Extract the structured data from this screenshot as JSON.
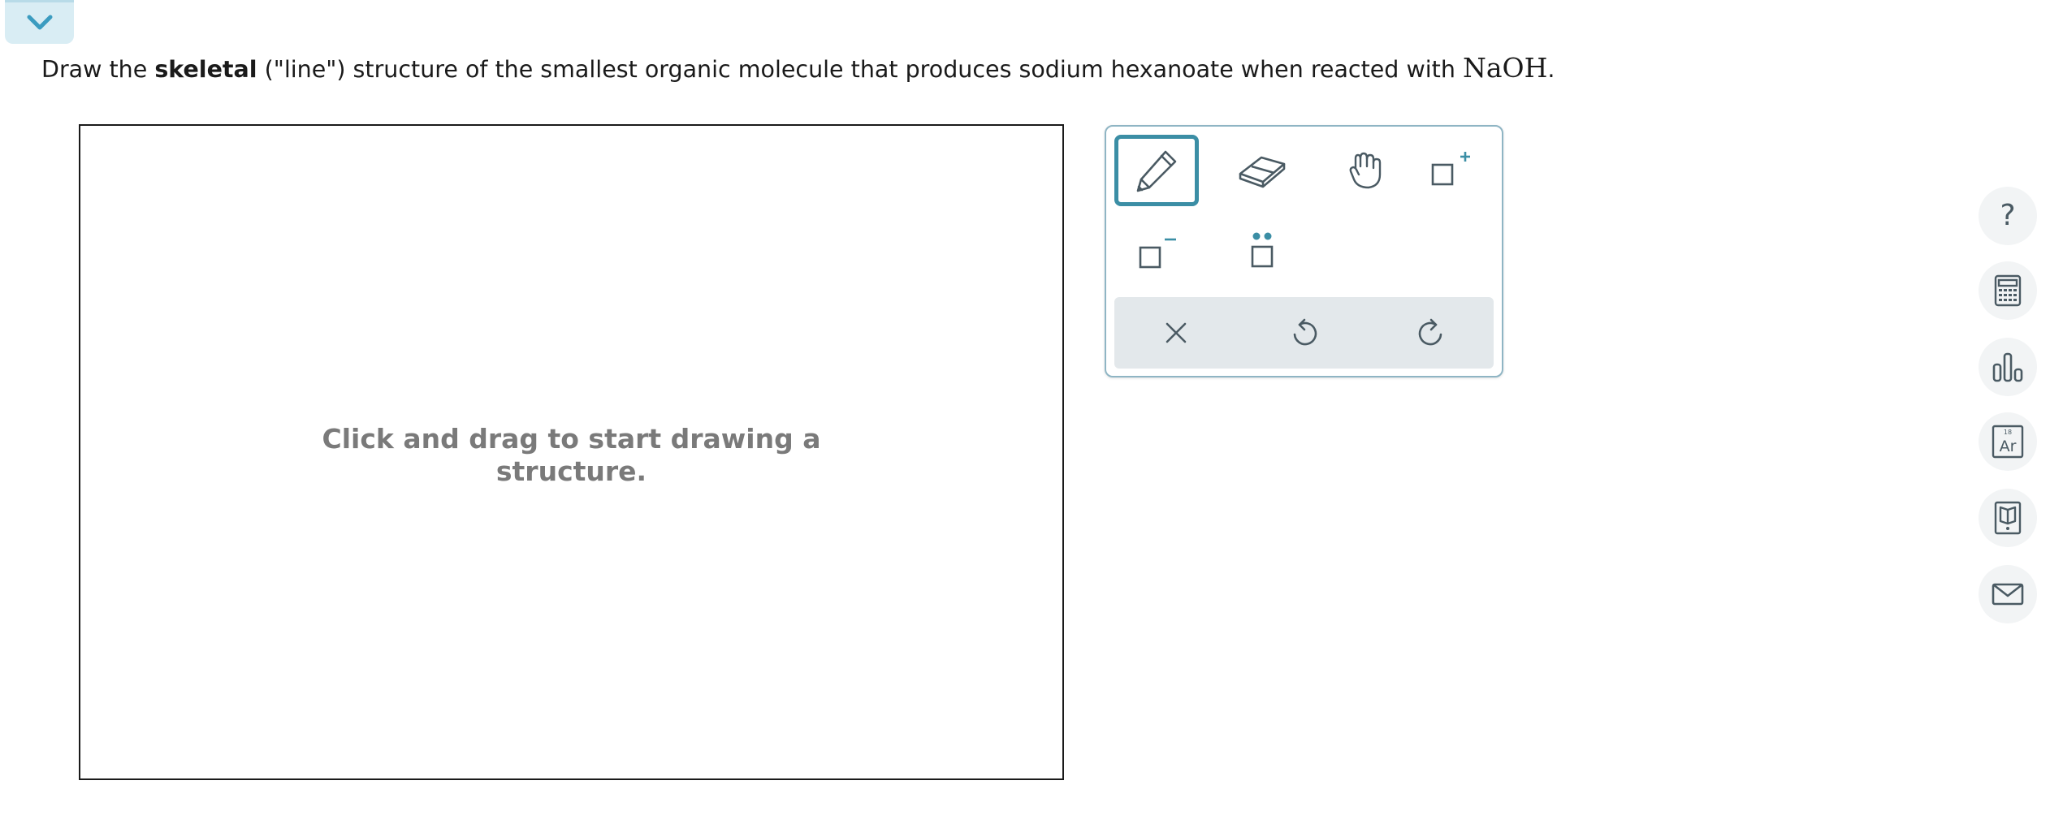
{
  "header": {
    "collapse_icon": "chevron-down-icon"
  },
  "question": {
    "prefix": "Draw the ",
    "bold": "skeletal",
    "middle": " (\"line\") structure of the smallest organic molecule that produces sodium hexanoate when reacted with ",
    "formula": "NaOH",
    "suffix": "."
  },
  "canvas": {
    "hint_line1": "Click and drag to start drawing a",
    "hint_line2": "structure."
  },
  "toolbox": {
    "tools": [
      {
        "name": "pencil-icon",
        "selected": true
      },
      {
        "name": "eraser-icon",
        "selected": false
      },
      {
        "name": "hand-icon",
        "selected": false
      },
      {
        "name": "positive-charge-icon",
        "selected": false
      },
      {
        "name": "negative-charge-icon",
        "selected": false
      },
      {
        "name": "lone-pair-icon",
        "selected": false
      }
    ],
    "actions": [
      "clear-icon",
      "undo-icon",
      "redo-icon"
    ]
  },
  "side_rail": {
    "help_label": "?",
    "periodic_number": "18",
    "periodic_symbol": "Ar",
    "icons": [
      "help-icon",
      "calculator-icon",
      "data-chart-icon",
      "periodic-table-icon",
      "reference-book-icon",
      "message-icon"
    ]
  },
  "colors": {
    "accent": "#3b8ea5",
    "icon_dark": "#4a5a63",
    "tab_bg": "#d9edf4",
    "action_bar_bg": "#e3e8eb"
  }
}
